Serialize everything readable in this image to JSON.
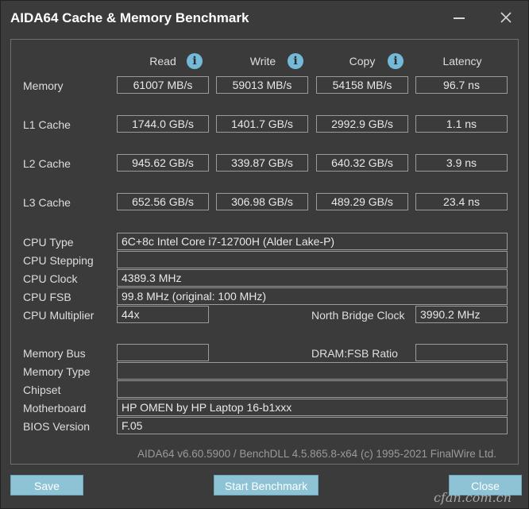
{
  "window": {
    "title": "AIDA64 Cache & Memory Benchmark"
  },
  "columns": {
    "read": "Read",
    "write": "Write",
    "copy": "Copy",
    "latency": "Latency"
  },
  "bench_rows": [
    {
      "label": "Memory",
      "read": "61007 MB/s",
      "write": "59013 MB/s",
      "copy": "54158 MB/s",
      "latency": "96.7 ns"
    },
    {
      "label": "L1 Cache",
      "read": "1744.0 GB/s",
      "write": "1401.7 GB/s",
      "copy": "2992.9 GB/s",
      "latency": "1.1 ns"
    },
    {
      "label": "L2 Cache",
      "read": "945.62 GB/s",
      "write": "339.87 GB/s",
      "copy": "640.32 GB/s",
      "latency": "3.9 ns"
    },
    {
      "label": "L3 Cache",
      "read": "652.56 GB/s",
      "write": "306.98 GB/s",
      "copy": "489.29 GB/s",
      "latency": "23.4 ns"
    }
  ],
  "cpu": {
    "type_label": "CPU Type",
    "type_value": "6C+8c Intel Core i7-12700H  (Alder Lake-P)",
    "stepping_label": "CPU Stepping",
    "stepping_value": "",
    "clock_label": "CPU Clock",
    "clock_value": "4389.3 MHz",
    "fsb_label": "CPU FSB",
    "fsb_value": "99.8 MHz  (original: 100 MHz)",
    "multiplier_label": "CPU Multiplier",
    "multiplier_value": "44x",
    "nb_clock_label": "North Bridge Clock",
    "nb_clock_value": "3990.2 MHz"
  },
  "memory_info": {
    "bus_label": "Memory Bus",
    "bus_value": "",
    "dram_ratio_label": "DRAM:FSB Ratio",
    "dram_ratio_value": "",
    "type_label": "Memory Type",
    "type_value": "",
    "chipset_label": "Chipset",
    "chipset_value": "",
    "motherboard_label": "Motherboard",
    "motherboard_value": "HP OMEN by HP Laptop 16-b1xxx",
    "bios_label": "BIOS Version",
    "bios_value": "F.05"
  },
  "footer": "AIDA64 v6.60.5900 / BenchDLL 4.5.865.8-x64  (c) 1995-2021 FinalWire Ltd.",
  "buttons": {
    "save": "Save",
    "start": "Start Benchmark",
    "close": "Close"
  },
  "watermark": "cfan.com.cn",
  "colors": {
    "background": "#3b3b3b",
    "button": "#8ec3d6",
    "info_icon": "#74b9d8"
  },
  "icons": {
    "info": "info-icon",
    "minimize": "minimize-icon",
    "close": "close-icon"
  }
}
